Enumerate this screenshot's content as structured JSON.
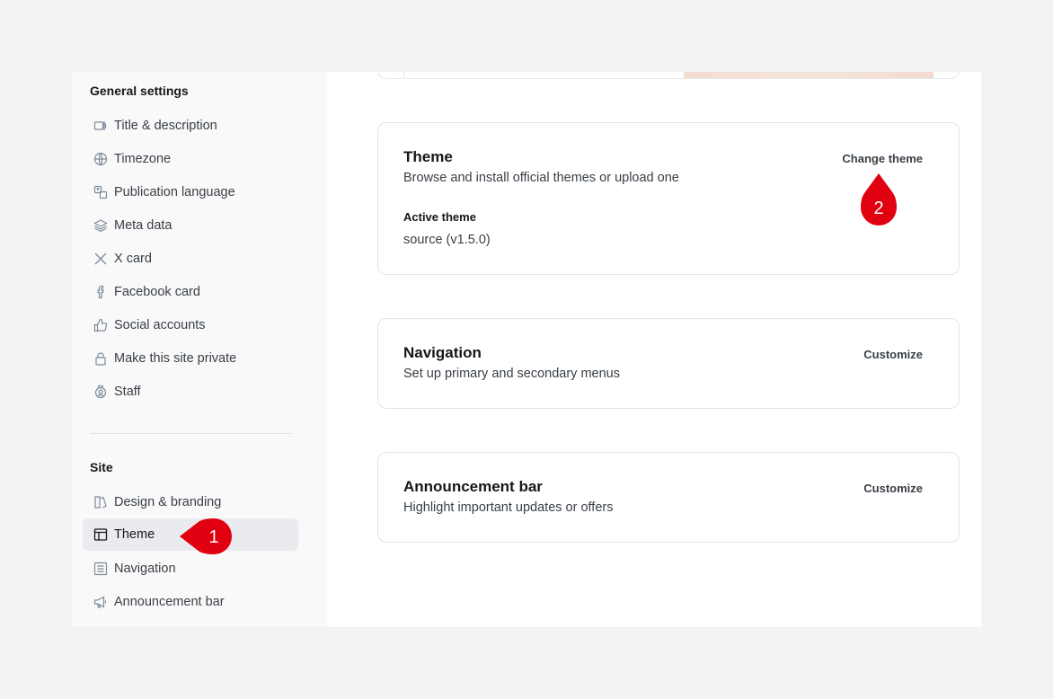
{
  "sidebar": {
    "general_title": "General settings",
    "general_items": [
      {
        "label": "Title & description",
        "icon": "title-icon"
      },
      {
        "label": "Timezone",
        "icon": "globe-icon"
      },
      {
        "label": "Publication language",
        "icon": "language-icon"
      },
      {
        "label": "Meta data",
        "icon": "layers-icon"
      },
      {
        "label": "X card",
        "icon": "x-icon"
      },
      {
        "label": "Facebook card",
        "icon": "facebook-icon"
      },
      {
        "label": "Social accounts",
        "icon": "thumbs-up-icon"
      },
      {
        "label": "Make this site private",
        "icon": "lock-icon"
      },
      {
        "label": "Staff",
        "icon": "staff-icon"
      }
    ],
    "site_title": "Site",
    "site_items": [
      {
        "label": "Design & branding",
        "icon": "brush-icon"
      },
      {
        "label": "Theme",
        "icon": "layout-icon",
        "active": true
      },
      {
        "label": "Navigation",
        "icon": "list-icon"
      },
      {
        "label": "Announcement bar",
        "icon": "megaphone-icon"
      }
    ]
  },
  "theme_card": {
    "title": "Theme",
    "description": "Browse and install official themes or upload one",
    "action": "Change theme",
    "active_label": "Active theme",
    "active_value": "source (v1.5.0)"
  },
  "navigation_card": {
    "title": "Navigation",
    "description": "Set up primary and secondary menus",
    "action": "Customize"
  },
  "announcement_card": {
    "title": "Announcement bar",
    "description": "Highlight important updates or offers",
    "action": "Customize"
  },
  "markers": [
    "1",
    "2"
  ],
  "colors": {
    "marker_red": "#e0000f",
    "active_bg": "#e9ebee",
    "sidebar_bg": "#f9f9fa",
    "page_bg": "#f2f3f5"
  }
}
